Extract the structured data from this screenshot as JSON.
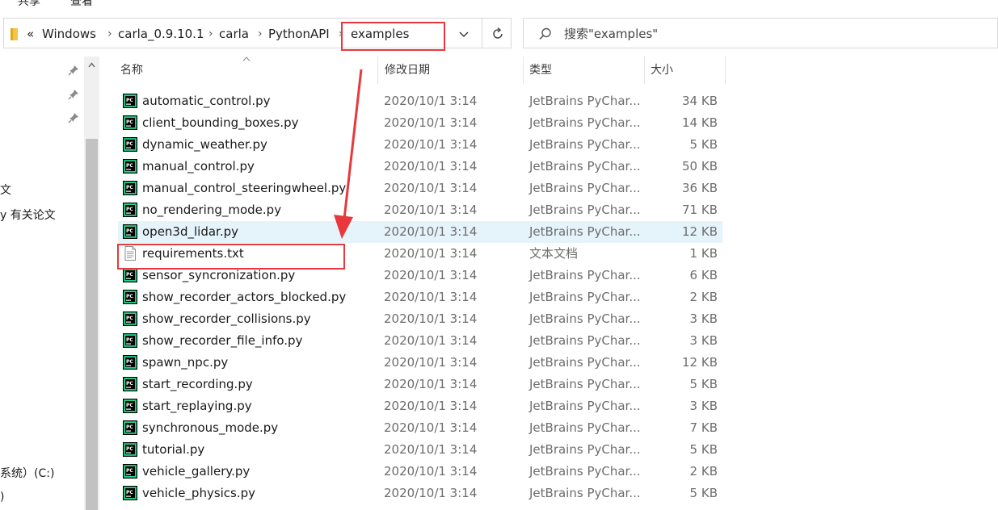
{
  "ribbon": {
    "tab_share": "共享",
    "tab_view": "查看"
  },
  "address": {
    "lead": "«",
    "breadcrumbs": [
      "Windows",
      "carla_0.9.10.1",
      "carla",
      "PythonAPI",
      "examples"
    ],
    "separator": "›"
  },
  "search": {
    "placeholder": "搜索\"examples\""
  },
  "nav": {
    "items": [
      "文",
      "y 有关论文",
      "系统）(C:)",
      ")"
    ]
  },
  "columns": {
    "name": "名称",
    "date": "修改日期",
    "type": "类型",
    "size": "大小"
  },
  "files": [
    {
      "name": "automatic_control.py",
      "date": "2020/10/1 3:14",
      "type": "JetBrains PyChar...",
      "size": "34 KB",
      "icon": "pycharm-file-icon"
    },
    {
      "name": "client_bounding_boxes.py",
      "date": "2020/10/1 3:14",
      "type": "JetBrains PyChar...",
      "size": "14 KB",
      "icon": "pycharm-file-icon"
    },
    {
      "name": "dynamic_weather.py",
      "date": "2020/10/1 3:14",
      "type": "JetBrains PyChar...",
      "size": "5 KB",
      "icon": "pycharm-file-icon"
    },
    {
      "name": "manual_control.py",
      "date": "2020/10/1 3:14",
      "type": "JetBrains PyChar...",
      "size": "50 KB",
      "icon": "pycharm-file-icon"
    },
    {
      "name": "manual_control_steeringwheel.py",
      "date": "2020/10/1 3:14",
      "type": "JetBrains PyChar...",
      "size": "36 KB",
      "icon": "pycharm-file-icon"
    },
    {
      "name": "no_rendering_mode.py",
      "date": "2020/10/1 3:14",
      "type": "JetBrains PyChar...",
      "size": "71 KB",
      "icon": "pycharm-file-icon"
    },
    {
      "name": "open3d_lidar.py",
      "date": "2020/10/1 3:14",
      "type": "JetBrains PyChar...",
      "size": "12 KB",
      "icon": "pycharm-file-icon"
    },
    {
      "name": "requirements.txt",
      "date": "2020/10/1 3:14",
      "type": "文本文档",
      "size": "1 KB",
      "icon": "text-file-icon"
    },
    {
      "name": "sensor_syncronization.py",
      "date": "2020/10/1 3:14",
      "type": "JetBrains PyChar...",
      "size": "6 KB",
      "icon": "pycharm-file-icon"
    },
    {
      "name": "show_recorder_actors_blocked.py",
      "date": "2020/10/1 3:14",
      "type": "JetBrains PyChar...",
      "size": "2 KB",
      "icon": "pycharm-file-icon"
    },
    {
      "name": "show_recorder_collisions.py",
      "date": "2020/10/1 3:14",
      "type": "JetBrains PyChar...",
      "size": "3 KB",
      "icon": "pycharm-file-icon"
    },
    {
      "name": "show_recorder_file_info.py",
      "date": "2020/10/1 3:14",
      "type": "JetBrains PyChar...",
      "size": "3 KB",
      "icon": "pycharm-file-icon"
    },
    {
      "name": "spawn_npc.py",
      "date": "2020/10/1 3:14",
      "type": "JetBrains PyChar...",
      "size": "12 KB",
      "icon": "pycharm-file-icon"
    },
    {
      "name": "start_recording.py",
      "date": "2020/10/1 3:14",
      "type": "JetBrains PyChar...",
      "size": "5 KB",
      "icon": "pycharm-file-icon"
    },
    {
      "name": "start_replaying.py",
      "date": "2020/10/1 3:14",
      "type": "JetBrains PyChar...",
      "size": "3 KB",
      "icon": "pycharm-file-icon"
    },
    {
      "name": "synchronous_mode.py",
      "date": "2020/10/1 3:14",
      "type": "JetBrains PyChar...",
      "size": "7 KB",
      "icon": "pycharm-file-icon"
    },
    {
      "name": "tutorial.py",
      "date": "2020/10/1 3:14",
      "type": "JetBrains PyChar...",
      "size": "5 KB",
      "icon": "pycharm-file-icon"
    },
    {
      "name": "vehicle_gallery.py",
      "date": "2020/10/1 3:14",
      "type": "JetBrains PyChar...",
      "size": "2 KB",
      "icon": "pycharm-file-icon"
    },
    {
      "name": "vehicle_physics.py",
      "date": "2020/10/1 3:14",
      "type": "JetBrains PyChar...",
      "size": "5 KB",
      "icon": "pycharm-file-icon"
    }
  ],
  "selected_file": "open3d_lidar.py",
  "colors": {
    "annotation": "#e8383d",
    "selection": "#e5f3fb",
    "pycharm_green": "#21d789"
  }
}
